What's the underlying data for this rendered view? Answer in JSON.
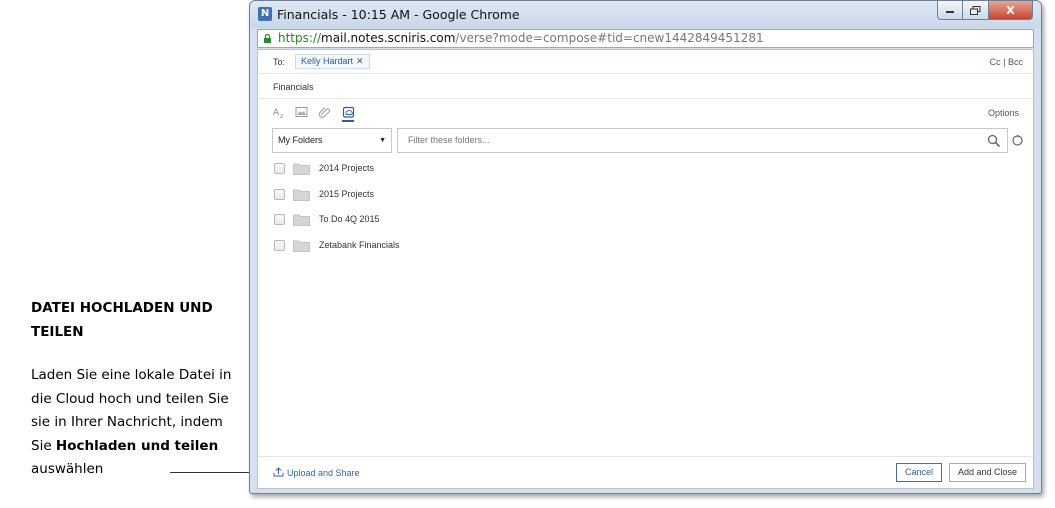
{
  "annotation": {
    "title": "DATEI HOCHLADEN UND TEILEN",
    "body_prefix": "Laden Sie eine lokale Datei in die Cloud hoch und teilen Sie sie in Ihrer Nachricht, indem Sie ",
    "body_bold": "Hochladen und teilen",
    "body_suffix": " auswählen"
  },
  "window": {
    "title": "Financials - 10:15 AM - Google Chrome",
    "url_scheme": "https://",
    "url_host": "mail.notes.scniris.com",
    "url_path": "/verse?mode=compose#tid=cnew1442849451281",
    "close_glyph": "X"
  },
  "compose": {
    "to_label": "To:",
    "recipient": "Kelly Hardart",
    "recipient_remove": "✕",
    "cc_bcc": "Cc | Bcc",
    "subject": "Financials",
    "options": "Options"
  },
  "folders": {
    "selected": "My Folders",
    "filter_placeholder": "Filter these folders...",
    "items": [
      {
        "name": "2014 Projects"
      },
      {
        "name": "2015 Projects"
      },
      {
        "name": "To Do 4Q 2015"
      },
      {
        "name": "Zetabank Financials"
      }
    ]
  },
  "footer": {
    "upload_label": "Upload and Share",
    "cancel_label": "Cancel",
    "add_close_label": "Add and Close"
  },
  "colors": {
    "accent": "#2f5e9e",
    "link": "#2f66b3",
    "secure_url": "#1a8a1a"
  }
}
